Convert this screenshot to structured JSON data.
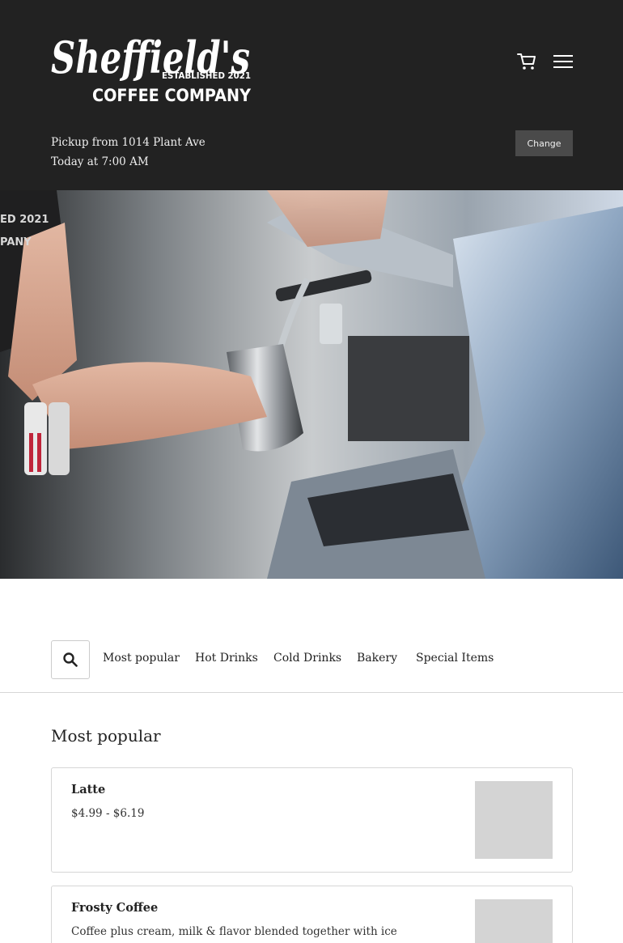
{
  "header": {
    "logo": {
      "script_text": "Sheffield's",
      "established_text": "ESTABLISHED 2021",
      "company_text": "COFFEE COMPANY"
    },
    "cart_icon": "shopping-cart-icon",
    "menu_icon": "hamburger-menu-icon",
    "pickup_line": "Pickup from 1014 Plant Ave",
    "time_line": "Today at 7:00 AM",
    "change_label": "Change"
  },
  "hero": {
    "image": "barista-steaming-milk-at-espresso-machine-photo",
    "shirt_text": "ED 2021 ... PANY"
  },
  "category_nav": {
    "search_icon": "search-icon",
    "tabs": [
      {
        "label": "Most popular"
      },
      {
        "label": "Hot Drinks"
      },
      {
        "label": "Cold Drinks"
      },
      {
        "label": "Bakery"
      },
      {
        "label": "Special Items"
      }
    ]
  },
  "section": {
    "title": "Most popular",
    "items": [
      {
        "name": "Latte",
        "detail": "$4.99 - $6.19"
      },
      {
        "name": "Frosty Coffee",
        "detail": "Coffee plus cream, milk & flavor blended together with ice"
      }
    ]
  },
  "colors": {
    "header_bg": "#222222",
    "change_button_bg": "#4a4a4a",
    "divider": "#d6d6d6",
    "thumb_placeholder": "#d4d4d4"
  }
}
